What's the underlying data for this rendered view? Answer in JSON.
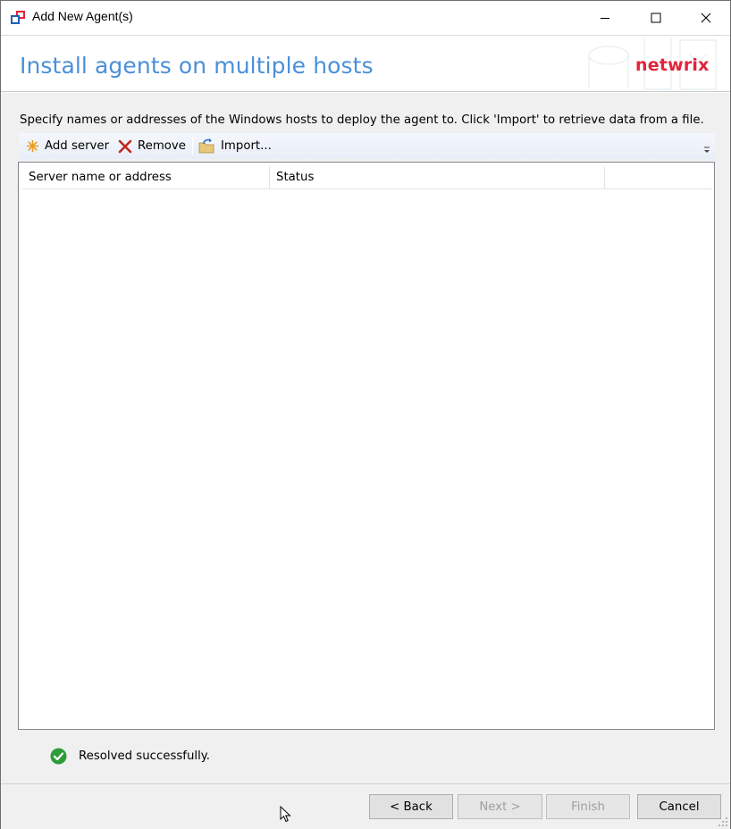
{
  "window": {
    "title": "Add New Agent(s)"
  },
  "header": {
    "title": "Install agents on multiple hosts",
    "logo": "netwrix"
  },
  "instruction": "Specify names or addresses of the Windows hosts to deploy the agent to. Click 'Import' to retrieve data from a file.",
  "toolbar": {
    "add_label": "Add server",
    "remove_label": "Remove",
    "import_label": "Import..."
  },
  "grid": {
    "columns": [
      "Server name or address",
      "Status",
      ""
    ],
    "rows": []
  },
  "status": {
    "text": "Resolved successfully.",
    "icon": "check-circle-icon",
    "color": "#2e9c3a"
  },
  "buttons": {
    "back": "< Back",
    "next": "Next >",
    "finish": "Finish",
    "cancel": "Cancel"
  },
  "colors": {
    "header_title": "#4a90d9",
    "logo": "#e2233b"
  }
}
